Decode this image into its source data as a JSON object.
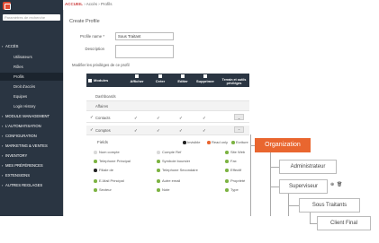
{
  "sidebar": {
    "search_placeholder": "Paramètres de recherche",
    "items": [
      {
        "label": "ACCÈS",
        "sub": false,
        "active": false,
        "chev": true
      },
      {
        "label": "Utilisateurs",
        "sub": true,
        "active": false
      },
      {
        "label": "Rôles",
        "sub": true,
        "active": false
      },
      {
        "label": "Profils",
        "sub": true,
        "active": true
      },
      {
        "label": "Droit d'accès",
        "sub": true,
        "active": false
      },
      {
        "label": "Equipes",
        "sub": true,
        "active": false
      },
      {
        "label": "Login History",
        "sub": true,
        "active": false
      },
      {
        "label": "MODULE MANAGEMENT",
        "sub": false,
        "chev": true
      },
      {
        "label": "L'AUTOMATISATION",
        "sub": false,
        "chev": true
      },
      {
        "label": "CONFIGURATION",
        "sub": false,
        "chev": true
      },
      {
        "label": "MARKETING & VENTES",
        "sub": false,
        "chev": true
      },
      {
        "label": "INVENTORY",
        "sub": false,
        "chev": true
      },
      {
        "label": "MES PRÉFÉRENCES",
        "sub": false,
        "chev": true
      },
      {
        "label": "EXTENSIONS",
        "sub": false,
        "chev": true
      },
      {
        "label": "AUTRES REGLAGES",
        "sub": false,
        "chev": true
      }
    ]
  },
  "topbar": {
    "home": "ACCUEIL",
    "crumb": "› Accès › Profils"
  },
  "form": {
    "title": "Create Profile",
    "profile_name_label": "Profile name *",
    "profile_name_value": "Sous Traitant",
    "description_label": "Description",
    "description_value": "",
    "section": "Modifier les privilèges de ce profil"
  },
  "grid": {
    "headers": [
      "Modules",
      "Afficher",
      "Créer",
      "Editer",
      "Supprimer",
      "Terrain et outils privilèges"
    ],
    "rows": [
      {
        "label": "Dashboards",
        "checked": false,
        "ticks": [
          false,
          false,
          false,
          false
        ],
        "expand": false
      },
      {
        "label": "Affaires",
        "checked": false,
        "ticks": [
          false,
          false,
          false,
          false
        ],
        "expand": false
      },
      {
        "label": "Contacts",
        "checked": true,
        "ticks": [
          true,
          true,
          true,
          true
        ],
        "expand": true
      },
      {
        "label": "Comptes",
        "checked": true,
        "ticks": [
          true,
          true,
          true,
          true
        ],
        "expand": true
      }
    ]
  },
  "fields": {
    "title": "Fields",
    "legend": [
      "Invisible",
      "Read only",
      "Ecriture"
    ],
    "items": [
      {
        "label": "Num compte",
        "color": "#d9d9d9"
      },
      {
        "label": "Compte Ref",
        "color": "#d9d9d9"
      },
      {
        "label": "Site Web",
        "color": "#7cb342"
      },
      {
        "label": "Telephone Principal",
        "color": "#7cb342"
      },
      {
        "label": "Symbole boursier",
        "color": "#7cb342"
      },
      {
        "label": "Fax",
        "color": "#7cb342"
      },
      {
        "label": "Filiale de",
        "color": "#222222"
      },
      {
        "label": "Telephone Secondaire",
        "color": "#7cb342"
      },
      {
        "label": "Effectif",
        "color": "#7cb342"
      },
      {
        "label": "E-Mail Principal",
        "color": "#7cb342"
      },
      {
        "label": "Autre email",
        "color": "#7cb342"
      },
      {
        "label": "Propriété",
        "color": "#7cb342"
      },
      {
        "label": "Secteur",
        "color": "#7cb342"
      },
      {
        "label": "Note",
        "color": "#7cb342"
      },
      {
        "label": "Type",
        "color": "#7cb342"
      }
    ]
  },
  "org": {
    "root": "Organization",
    "nodes": [
      "Administrateur",
      "Superviseur",
      "Sous Traitants",
      "Client Final"
    ]
  },
  "colors": {
    "sidebar": "#2a3542",
    "accent": "#e9662f",
    "green": "#7cb342"
  }
}
